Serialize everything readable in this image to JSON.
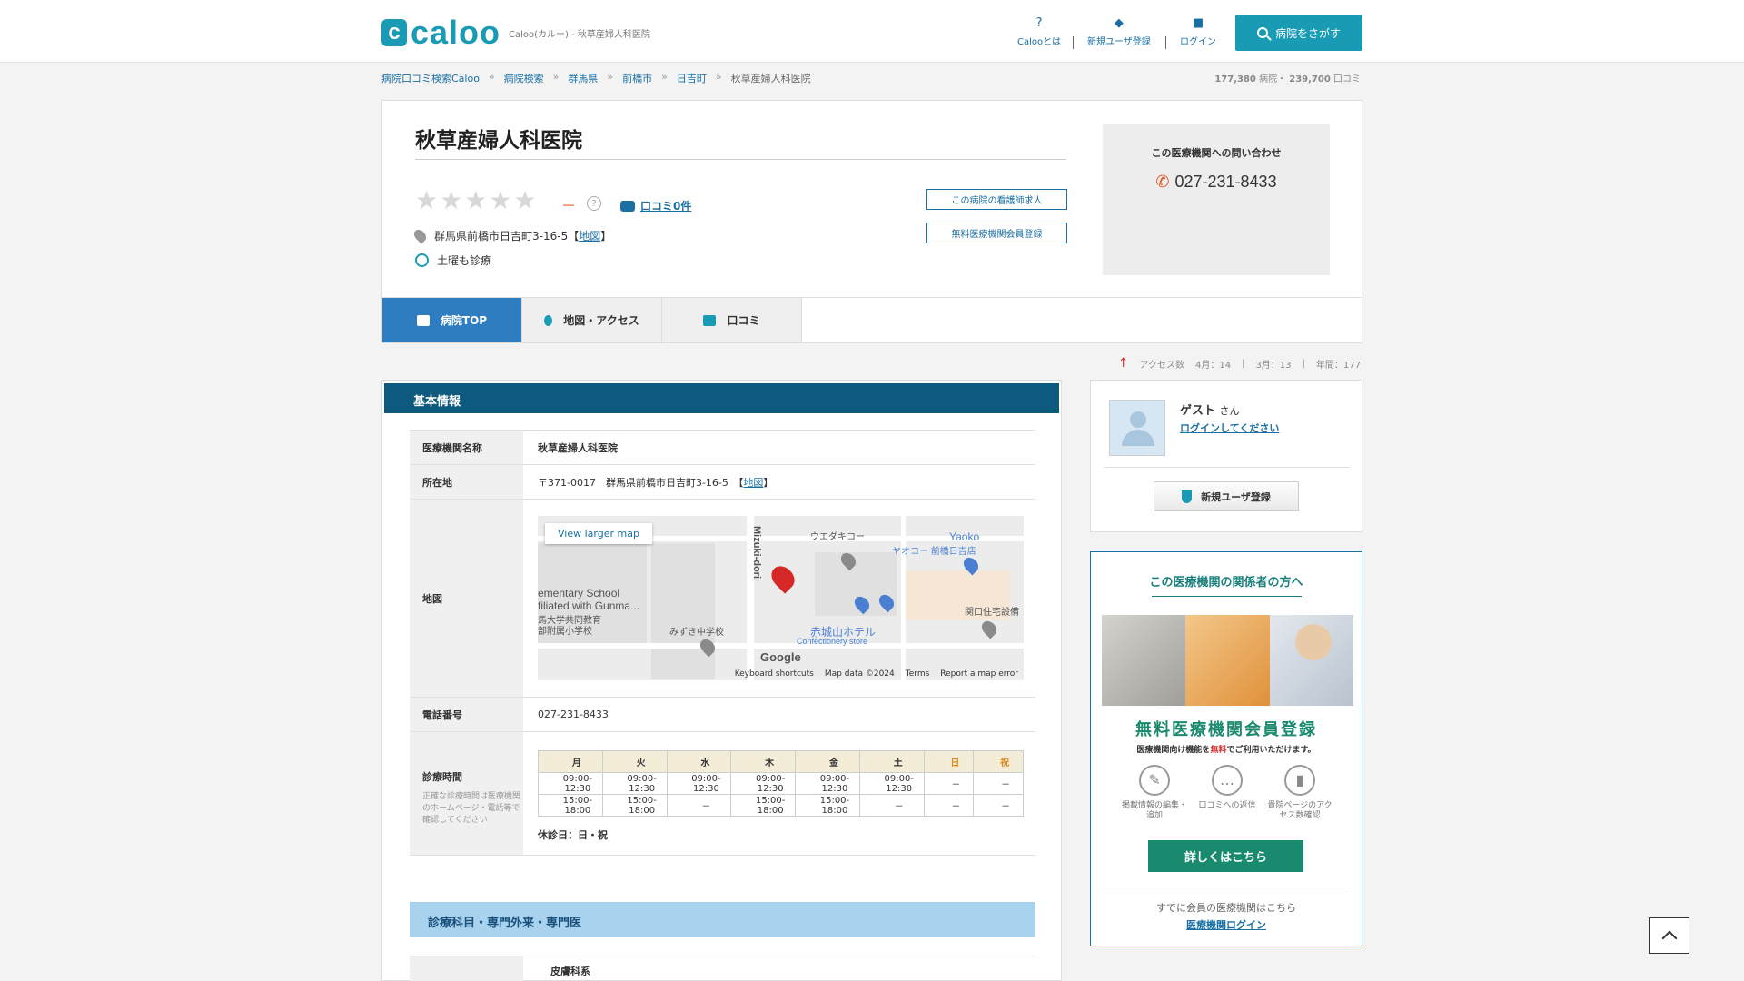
{
  "header": {
    "logo_mark": "c",
    "logo_text": "caloo",
    "site_sub": "Caloo(カルー) - 秋草産婦人科医院",
    "nav": [
      {
        "label": "Calooとは",
        "icon": "question-circle-icon"
      },
      {
        "label": "新規ユーザ登録",
        "icon": "beginner-leaf-icon"
      },
      {
        "label": "ログイン",
        "icon": "lock-icon"
      }
    ],
    "search_label": "病院をさがす"
  },
  "breadcrumb": [
    "病院口コミ検索Caloo",
    "病院検索",
    "群馬県",
    "前橋市",
    "日吉町",
    "秋草産婦人科医院"
  ],
  "site_stats": {
    "hospitals": "177,380",
    "hospitals_unit": "病院・",
    "reviews": "239,700",
    "reviews_unit": "口コミ"
  },
  "hospital": {
    "name": "秋草産婦人科医院",
    "rating_dash": "－",
    "help": "?",
    "review_link": "口コミ0件",
    "address": "群馬県前橋市日吉町3-16-5【",
    "map_link": "地図",
    "address_close": "】",
    "saturday": "土曜も診療",
    "nurse_btn": "この病院の看護師求人",
    "member_btn": "無料医療機関会員登録"
  },
  "contact": {
    "label": "この医療機関への問い合わせ",
    "tel": "027-231-8433"
  },
  "tabs": [
    {
      "label": "病院TOP",
      "active": true
    },
    {
      "label": "地図・アクセス",
      "active": false
    },
    {
      "label": "口コミ",
      "active": false
    }
  ],
  "access": {
    "label": "アクセス数",
    "april": "4月：14",
    "march": "3月：13",
    "year": "年間：177",
    "sep": "|"
  },
  "basic": {
    "heading": "基本情報",
    "rows": {
      "name_label": "医療機関名称",
      "name_value": "秋草産婦人科医院",
      "addr_label": "所在地",
      "addr_value": "〒371-0017　群馬県前橋市日吉町3-16-5　【",
      "addr_map": "地図",
      "addr_close": "】",
      "map_label": "地図",
      "tel_label": "電話番号",
      "tel_value": "027-231-8433",
      "hours_label": "診療時間",
      "hours_note": "正確な診療時間は医療機関のホームページ・電話等で確認してください"
    },
    "map": {
      "view_larger": "View larger map",
      "labels": [
        "ementary School",
        "filiated with Gunma...",
        "馬大学共同教育",
        "部附属小学校",
        "Mizuki-dori",
        "ウエダキコー",
        "Yaoko",
        "ヤオコー 前橋日吉店",
        "関口住宅設備",
        "みずき中学校",
        "赤城山ホテル",
        "Confectionery store"
      ],
      "google": "Google",
      "footer": [
        "Keyboard shortcuts",
        "Map data ©2024",
        "Terms",
        "Report a map error"
      ]
    },
    "hours": {
      "days": [
        "月",
        "火",
        "水",
        "木",
        "金",
        "土",
        "日",
        "祝"
      ],
      "rows": [
        [
          "09:00-12:30",
          "09:00-12:30",
          "09:00-12:30",
          "09:00-12:30",
          "09:00-12:30",
          "09:00-12:30",
          "－",
          "－"
        ],
        [
          "15:00-18:00",
          "15:00-18:00",
          "－",
          "15:00-18:00",
          "15:00-18:00",
          "－",
          "－",
          "－"
        ]
      ],
      "closed": "休診日：日・祝"
    },
    "dept_heading": "診療科目・専門外来・専門医",
    "dept_first": "皮膚科系"
  },
  "user": {
    "guest": "ゲスト",
    "san": "さん",
    "login": "ログインしてください",
    "register": "新規ユーザ登録"
  },
  "promo": {
    "title": "この医療機関の関係者の方へ",
    "big": "無料医療機関会員登録",
    "sub_pre": "医療機関向け機能を",
    "sub_red": "無料",
    "sub_post": "でご利用いただけます。",
    "features": [
      "掲載情報の編集・追加",
      "口コミへの返信",
      "貴院ページのアクセス数確認"
    ],
    "detail": "詳しくはこちら",
    "member": "すでに会員の医療機関はこちら",
    "login": "医療機関ログイン"
  }
}
